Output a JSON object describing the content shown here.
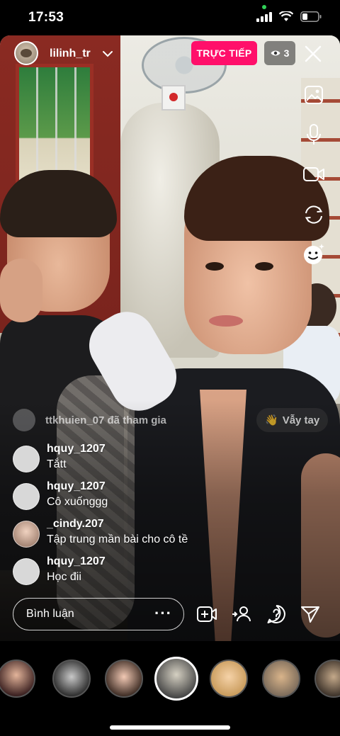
{
  "status_bar": {
    "time": "17:53"
  },
  "header": {
    "username": "lilinh_tr",
    "live_label": "TRỰC TIẾP",
    "viewer_count": "3"
  },
  "join_event": {
    "text": "ttkhuien_07 đã tham gia",
    "wave_label": "Vẫy tay"
  },
  "comments": [
    {
      "user": "hquy_1207",
      "text": "Tắtt"
    },
    {
      "user": "hquy_1207",
      "text": "Cô xuốnggg"
    },
    {
      "user": "_cindy.207",
      "text": "Tập trung mần bài cho cô tề"
    },
    {
      "user": "hquy_1207",
      "text": "Học đii"
    }
  ],
  "composer": {
    "placeholder": "Bình luận",
    "more": "···"
  },
  "right_tools": [
    "image-icon",
    "microphone-icon",
    "video-camera-icon",
    "flip-camera-icon",
    "face-effects-icon"
  ],
  "bottom_tools": [
    "add-guest-icon",
    "invite-people-icon",
    "question-icon",
    "share-send-icon"
  ],
  "colors": {
    "live_badge": "#ff0f6a",
    "status_green": "#31d158"
  }
}
